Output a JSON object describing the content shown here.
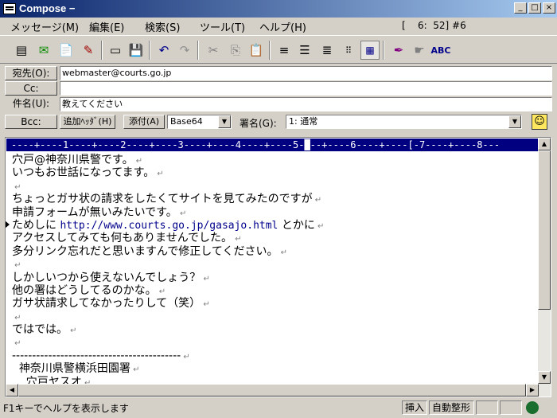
{
  "window": {
    "title": "Compose −"
  },
  "menu": {
    "items": [
      "メッセージ(M)",
      "編集(E)",
      "検索(S)",
      "ツール(T)",
      "ヘルプ(H)"
    ],
    "position": "[    6:  52] #6"
  },
  "toolbar": {
    "icons": [
      "send-queue-icon",
      "send-now-icon",
      "save-draft-icon",
      "edit-icon",
      "page-icon",
      "save-icon",
      "undo-icon",
      "redo-icon",
      "cut-icon",
      "copy-icon",
      "paste-icon",
      "align-center-icon",
      "align-left-icon",
      "align-right-icon",
      "dots-icon",
      "grid-icon",
      "signature-icon",
      "hand-icon",
      "spellcheck-icon"
    ]
  },
  "header": {
    "to_label": "宛先(O):",
    "to_value": "webmaster@courts.go.jp",
    "cc_label": "Cc:",
    "cc_value": "",
    "subject_label": "件名(U):",
    "subject_value": "教えてください",
    "bcc_label": "Bcc:",
    "add_header_label": "追加ﾍｯﾀﾞ(H)",
    "attach_label": "添付(A)",
    "encoding_value": "Base64",
    "signature_label": "署名(G):",
    "signature_value": "1: 通常"
  },
  "editor": {
    "ruler": "----+----1----+----2----+----3----+----4----+----5-█--+----6----+----[-7----+----8---",
    "lines": [
      "穴戸@神奈川県警です。",
      "いつもお世話になってます。",
      "",
      "ちょっとガサ状の請求をしたくてサイトを見てみたのですが",
      "申請フォームが無いみたいです。",
      "ためしに http://www.courts.go.jp/gasajo.html とかに",
      "アクセスしてみても何もありませんでした。",
      "多分リンク忘れだと思いますんで修正してください。",
      "",
      "しかしいつから使えないんでしょう？",
      "他の署はどうしてるのかな。",
      "ガサ状請求してなかったりして（笑）",
      "",
      "ではでは。",
      "",
      "------------------------------------------",
      "  神奈川県警横浜田園署",
      "    穴戸ヤスオ"
    ]
  },
  "status": {
    "help": "F1キーでヘルプを表示します",
    "insert": "挿入",
    "autoformat": "自動整形"
  }
}
